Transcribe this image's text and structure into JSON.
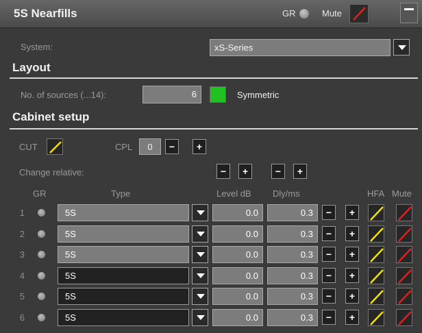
{
  "header": {
    "title": "5S Nearfills",
    "gr_label": "GR",
    "mute_label": "Mute"
  },
  "system": {
    "label": "System:",
    "value": "xS-Series"
  },
  "layout": {
    "heading": "Layout",
    "sources_label": "No. of sources (...14):",
    "sources_value": "6",
    "symmetric_label": "Symmetric"
  },
  "cabinet": {
    "heading": "Cabinet setup",
    "cut_label": "CUT",
    "cpl_label": "CPL",
    "cpl_value": "0",
    "change_relative_label": "Change relative:",
    "columns": {
      "gr": "GR",
      "type": "Type",
      "level": "Level dB",
      "dly": "Dly/ms",
      "hfa": "HFA",
      "mute": "Mute"
    },
    "rows": [
      {
        "num": "1",
        "type": "5S",
        "level": "0.0",
        "dly": "0.3"
      },
      {
        "num": "2",
        "type": "5S",
        "level": "0.0",
        "dly": "0.3"
      },
      {
        "num": "3",
        "type": "5S",
        "level": "0.0",
        "dly": "0.3"
      },
      {
        "num": "4",
        "type": "5S",
        "level": "0.0",
        "dly": "0.3"
      },
      {
        "num": "5",
        "type": "5S",
        "level": "0.0",
        "dly": "0.3"
      },
      {
        "num": "6",
        "type": "5S",
        "level": "0.0",
        "dly": "0.3"
      }
    ]
  },
  "buttons": {
    "minus": "−",
    "plus": "+"
  },
  "icons": {
    "yellow_slash": "#f2e200",
    "red_slash": "#e02020",
    "symmetric_color": "#1fc21f"
  }
}
